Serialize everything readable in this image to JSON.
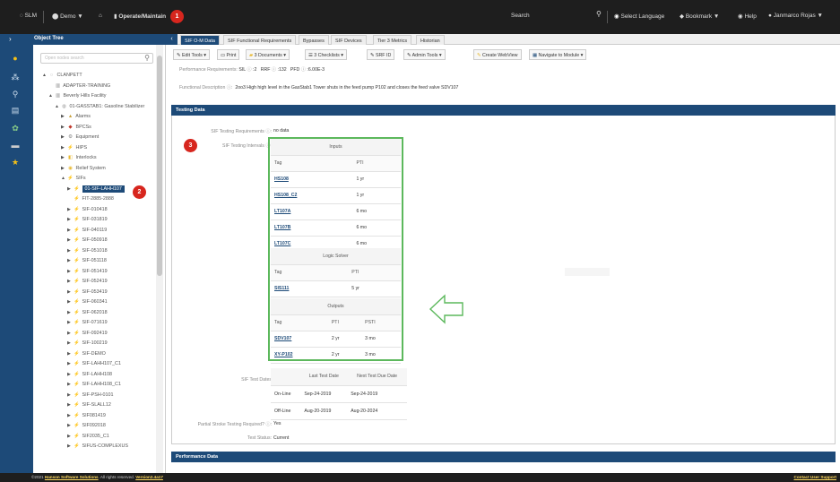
{
  "topbar": {
    "app": "SLM",
    "workspace": "Demo",
    "breadcrumb": "Operate/Maintain",
    "search": "Search",
    "language": "Select Language",
    "bookmark": "Bookmark",
    "help": "Help",
    "user": "Janmarco Rojas"
  },
  "badges": [
    "1",
    "2",
    "3"
  ],
  "object_tree": {
    "title": "Object Tree",
    "search_placeholder": "Open nodes search",
    "nodes": [
      {
        "label": "CLANPETT",
        "icon": "site-icon",
        "depth": 0,
        "expand": "▲"
      },
      {
        "label": "ADAPTER-TRAINING",
        "icon": "building-icon",
        "depth": 1,
        "expand": ""
      },
      {
        "label": "Beverly Hills Facility",
        "icon": "building-icon",
        "depth": 1,
        "expand": "▲"
      },
      {
        "label": "01-GASSTAB1: Gasoline Stabilizer",
        "icon": "unit-icon",
        "depth": 2,
        "expand": "▲"
      },
      {
        "label": "Alarms",
        "icon": "alarm-icon",
        "depth": 3,
        "expand": "▶"
      },
      {
        "label": "BPCSs",
        "icon": "bpcs-icon",
        "depth": 3,
        "expand": "▶"
      },
      {
        "label": "Equipment",
        "icon": "equipment-icon",
        "depth": 3,
        "expand": "▶"
      },
      {
        "label": "HIPS",
        "icon": "hips-icon",
        "depth": 3,
        "expand": "▶"
      },
      {
        "label": "Interlocks",
        "icon": "interlock-icon",
        "depth": 3,
        "expand": "▶"
      },
      {
        "label": "Relief System",
        "icon": "relief-icon",
        "depth": 3,
        "expand": "▶"
      },
      {
        "label": "SIFs",
        "icon": "sif-icon",
        "depth": 3,
        "expand": "▲"
      },
      {
        "label": "01-SIF-LAHH107",
        "icon": "sif-icon",
        "depth": 4,
        "expand": "▶",
        "selected": true
      },
      {
        "label": "FIT-2885-2888",
        "icon": "sif-icon",
        "depth": 4,
        "expand": ""
      },
      {
        "label": "SIF-010418",
        "icon": "sif-icon",
        "depth": 4,
        "expand": "▶"
      },
      {
        "label": "SIF-031819",
        "icon": "sif-icon",
        "depth": 4,
        "expand": "▶"
      },
      {
        "label": "SIF-040119",
        "icon": "sif-icon",
        "depth": 4,
        "expand": "▶"
      },
      {
        "label": "SIF-050918",
        "icon": "sif-icon",
        "depth": 4,
        "expand": "▶"
      },
      {
        "label": "SIF-051018",
        "icon": "sif-icon",
        "depth": 4,
        "expand": "▶"
      },
      {
        "label": "SIF-051118",
        "icon": "sif-icon",
        "depth": 4,
        "expand": "▶"
      },
      {
        "label": "SIF-051419",
        "icon": "sif-icon",
        "depth": 4,
        "expand": "▶"
      },
      {
        "label": "SIF-052419",
        "icon": "sif-icon",
        "depth": 4,
        "expand": "▶"
      },
      {
        "label": "SIF-053419",
        "icon": "sif-icon",
        "depth": 4,
        "expand": "▶"
      },
      {
        "label": "SIF-060341",
        "icon": "sif-icon",
        "depth": 4,
        "expand": "▶"
      },
      {
        "label": "SIF-062018",
        "icon": "sif-icon",
        "depth": 4,
        "expand": "▶"
      },
      {
        "label": "SIF-071619",
        "icon": "sif-icon",
        "depth": 4,
        "expand": "▶"
      },
      {
        "label": "SIF-092419",
        "icon": "sif-icon",
        "depth": 4,
        "expand": "▶"
      },
      {
        "label": "SIF-100219",
        "icon": "sif-icon",
        "depth": 4,
        "expand": "▶"
      },
      {
        "label": "SIF-DEMO",
        "icon": "sif-icon",
        "depth": 4,
        "expand": "▶"
      },
      {
        "label": "SIF-LAHH107_C1",
        "icon": "sif-icon",
        "depth": 4,
        "expand": "▶"
      },
      {
        "label": "SIF-LAHH108",
        "icon": "sif-icon",
        "depth": 4,
        "expand": "▶"
      },
      {
        "label": "SIF-LAHH108_C1",
        "icon": "sif-icon",
        "depth": 4,
        "expand": "▶"
      },
      {
        "label": "SIF-PSH-0101",
        "icon": "sif-icon",
        "depth": 4,
        "expand": "▶"
      },
      {
        "label": "SIF-SLALL12",
        "icon": "sif-icon",
        "depth": 4,
        "expand": "▶"
      },
      {
        "label": "SIF081419",
        "icon": "sif-icon",
        "depth": 4,
        "expand": "▶"
      },
      {
        "label": "SIF092018",
        "icon": "sif-icon",
        "depth": 4,
        "expand": "▶"
      },
      {
        "label": "SIF2035_C1",
        "icon": "sif-icon",
        "depth": 4,
        "expand": "▶"
      },
      {
        "label": "SIFUS-COMPLEXUS",
        "icon": "sif-icon",
        "depth": 4,
        "expand": "▶"
      }
    ]
  },
  "tabs": [
    "SIF O-M Data",
    "SIF Functional Requirements",
    "Bypasses",
    "SIF Devices",
    "Tier 3 Metrics",
    "Historian"
  ],
  "toolbar": [
    "Edit Tools",
    "Print",
    "3 Documents",
    "3 Checklists",
    "SRF ID",
    "Admin Tools",
    "Create WebView",
    "Navigate to Module"
  ],
  "perf_req": {
    "label": "Performance Requirements:",
    "sil": "SIL",
    "sil_val": "2",
    "rrf": "RRF",
    "rrf_val": "132",
    "pfd": "PFD",
    "pfd_val": "6.00E-3"
  },
  "functional_desc": {
    "label": "Functional Description",
    "text": "2oo3 High high level in the GasStab1 Tower shuts in the feed pump P102 and closes the feed valve SDV107"
  },
  "testing": {
    "title": "Testing Data",
    "req_label": "SIF Testing Requirements",
    "req_val": "no data",
    "int_label": "SIF Testing Intervals",
    "inputs": {
      "caption": "Inputs",
      "headers": [
        "Tag",
        "PTI"
      ],
      "rows": [
        [
          "HS108",
          "1 yr"
        ],
        [
          "HS108_C2",
          "1 yr"
        ],
        [
          "LT107A",
          "6 mo"
        ],
        [
          "LT107B",
          "6 mo"
        ],
        [
          "LT107C",
          "6 mo"
        ]
      ]
    },
    "logic": {
      "caption": "Logic Solver",
      "headers": [
        "Tag",
        "PTI"
      ],
      "rows": [
        [
          "SIS111",
          "5 yr"
        ]
      ]
    },
    "outputs": {
      "caption": "Outputs",
      "headers": [
        "Tag",
        "PTI",
        "PSTI"
      ],
      "rows": [
        [
          "SDV107",
          "2 yr",
          "3 mo"
        ],
        [
          "XY-P102",
          "2 yr",
          "3 mo"
        ]
      ]
    },
    "testdate_label": "SIF Test Dates",
    "testdate_headers": [
      "Last Test Date",
      "Next Test Due Date"
    ],
    "testdate_rows": [
      [
        "On-Line",
        "Sep-24-2019",
        "Sep-24-2019"
      ],
      [
        "Off-Line",
        "Aug-20-2019",
        "Aug-20-2024"
      ]
    ],
    "partial_label": "Partial Stroke Testing Required?",
    "partial_val": "Yes",
    "status_label": "Test Status:",
    "status_val": "Current"
  },
  "perf_data_title": "Performance Data",
  "footer": {
    "left_prefix": "©2021 ",
    "company": "Hanson Software Solutions",
    "rights": ". All rights reserved. ",
    "version": "Version2.4a17",
    "contact": "Contact User Support"
  }
}
